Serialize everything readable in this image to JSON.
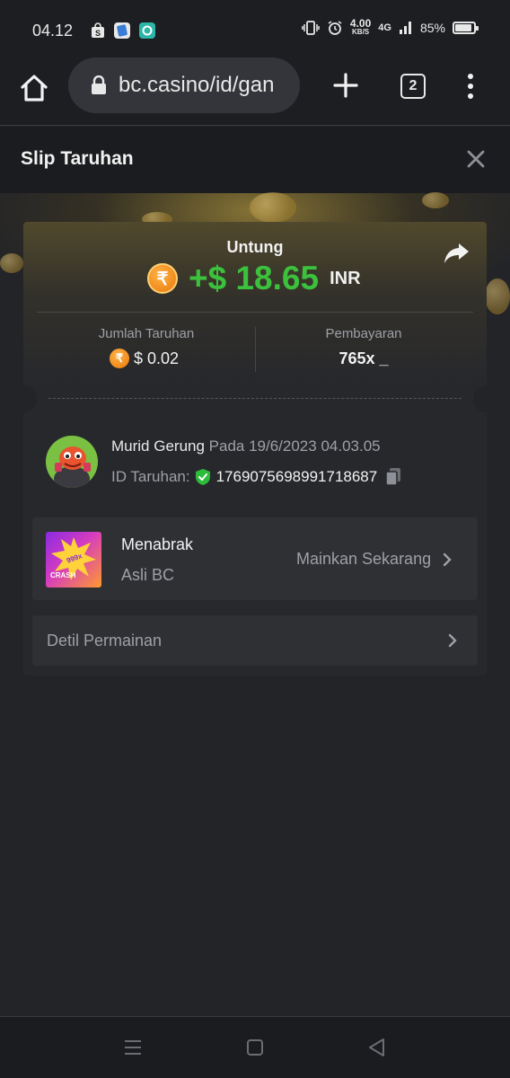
{
  "status_bar": {
    "time": "04.12",
    "speed_value": "4.00",
    "speed_unit": "KB/S",
    "network": "4G",
    "battery": "85%"
  },
  "browser": {
    "url": "bc.casino/id/gan",
    "tab_count": "2"
  },
  "modal": {
    "title": "Slip Taruhan"
  },
  "bet_card": {
    "profit_label": "Untung",
    "currency_symbol": "₹",
    "profit_amount": "+$ 18.65",
    "profit_currency": "INR",
    "bet_amount_label": "Jumlah Taruhan",
    "bet_amount": "$ 0.02",
    "payout_label": "Pembayaran",
    "payout_value": "765x _"
  },
  "player": {
    "name": "Murid Gerung",
    "date_text": " Pada 19/6/2023 04.03.05",
    "bet_id_label": "ID Taruhan:",
    "bet_id": "1769075698991718687"
  },
  "game": {
    "thumb_label": "CRASH",
    "thumb_badge": "999x",
    "name": "Menabrak",
    "provider": "Asli BC",
    "play_label": "Mainkan Sekarang"
  },
  "details": {
    "label": "Detil Permainan"
  },
  "colors": {
    "profit_green": "#3cc13c",
    "coin_orange": "#f08a1c",
    "background": "#232428"
  }
}
